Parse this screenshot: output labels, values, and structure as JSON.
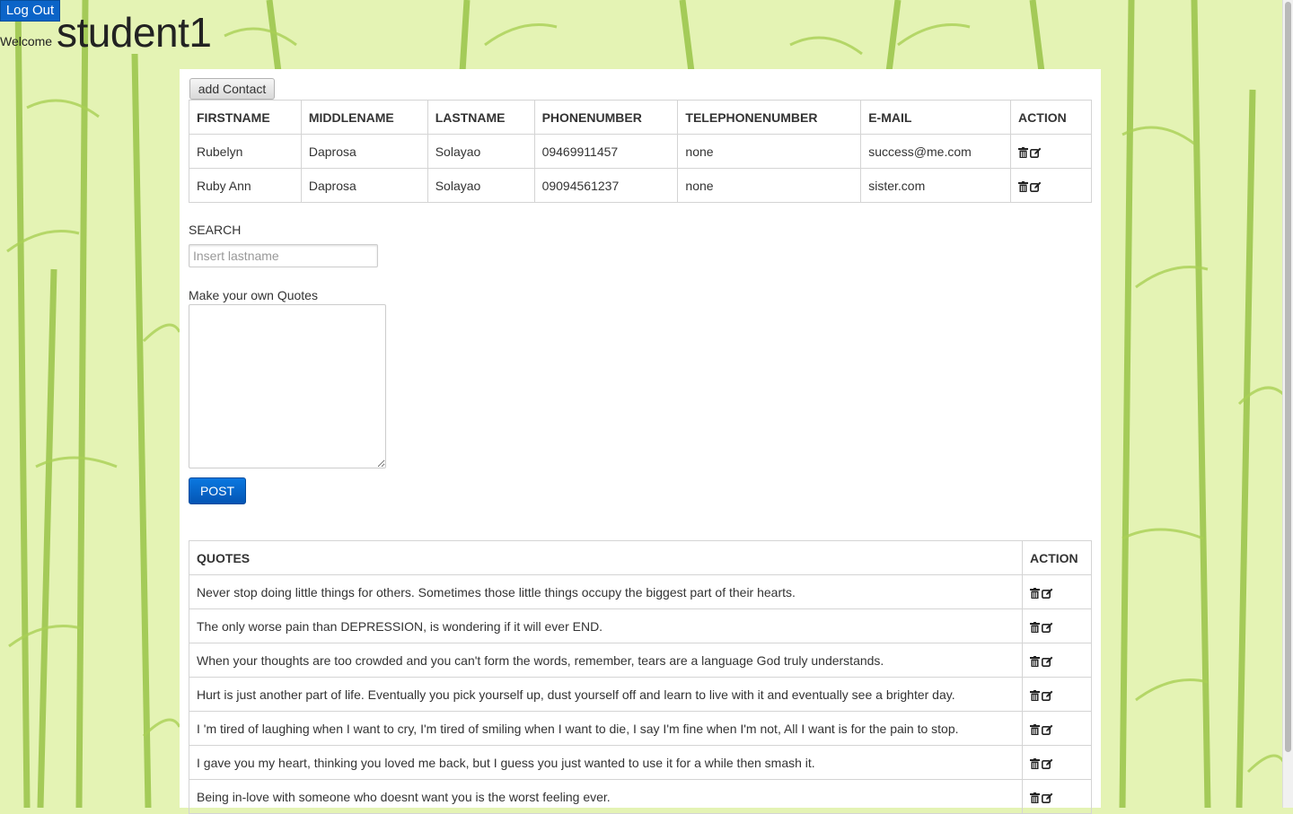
{
  "header": {
    "logout_label": "Log Out",
    "welcome_label": "Welcome",
    "username": "student1"
  },
  "contacts": {
    "add_button_label": "add Contact",
    "columns": [
      "FIRSTNAME",
      "MIDDLENAME",
      "LASTNAME",
      "PHONENUMBER",
      "TELEPHONENUMBER",
      "E-MAIL",
      "ACTION"
    ],
    "rows": [
      {
        "firstname": "Rubelyn",
        "middlename": "Daprosa",
        "lastname": "Solayao",
        "phonenumber": "09469911457",
        "telephonenumber": "none",
        "email": "success@me.com"
      },
      {
        "firstname": "Ruby Ann",
        "middlename": "Daprosa",
        "lastname": "Solayao",
        "phonenumber": "09094561237",
        "telephonenumber": "none",
        "email": "sister.com"
      }
    ],
    "action_icons": [
      "trash-icon",
      "edit-icon"
    ]
  },
  "search": {
    "label": "SEARCH",
    "placeholder": "Insert lastname",
    "value": ""
  },
  "quote_form": {
    "label": "Make your own Quotes",
    "value": "",
    "post_label": "POST"
  },
  "quotes": {
    "columns": [
      "QUOTES",
      "ACTION"
    ],
    "rows": [
      "Never stop doing little things for others. Sometimes those little things occupy the biggest part of their hearts.",
      "The only worse pain than DEPRESSION, is wondering if it will ever END.",
      "When your thoughts are too crowded and you can't form the words, remember, tears are a language God truly understands.",
      "Hurt is just another part of life. Eventually you pick yourself up, dust yourself off and learn to live with it and eventually see a brighter day.",
      "I 'm tired of laughing when I want to cry, I'm tired of smiling when I want to die, I say I'm fine when I'm not, All I want is for the pain to stop.",
      "I gave you my heart, thinking you loved me back, but I guess you just wanted to use it for a while then smash it.",
      "Being in-love with someone who doesnt want you is the worst feeling ever."
    ]
  },
  "colors": {
    "background": "#e4f3b4",
    "bamboo": "#7faa2b",
    "button_blue": "#0b64c8",
    "panel": "#ffffff"
  }
}
